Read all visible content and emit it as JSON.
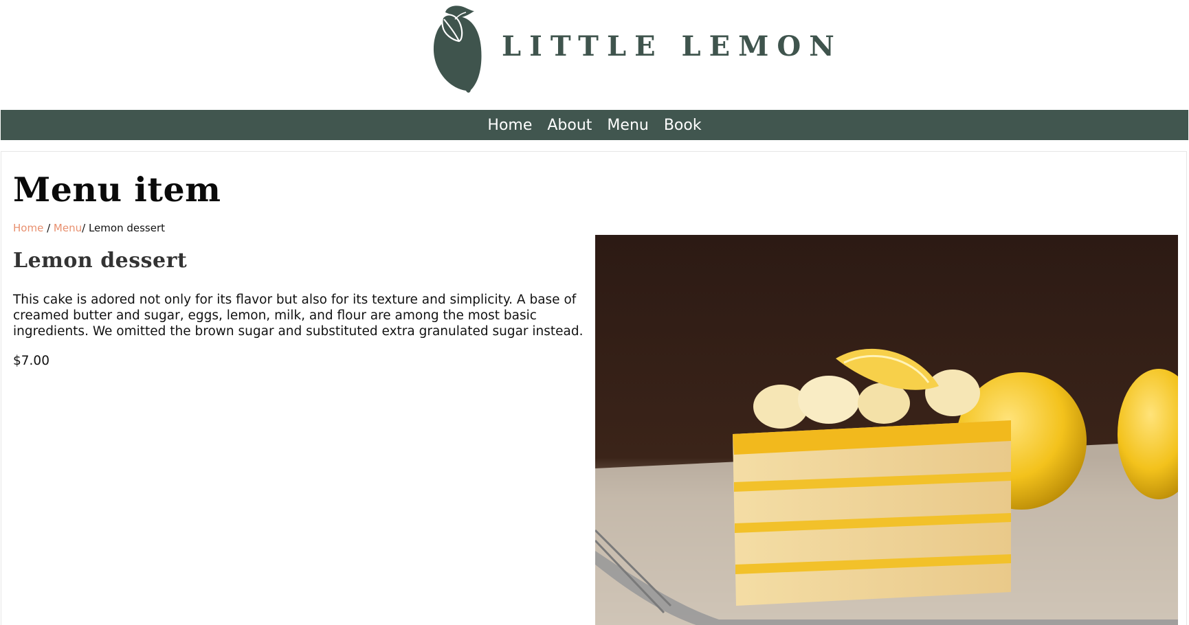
{
  "brand": {
    "name": "LITTLE LEMON",
    "color": "#3f544d"
  },
  "nav": {
    "items": [
      {
        "label": "Home"
      },
      {
        "label": "About"
      },
      {
        "label": "Menu"
      },
      {
        "label": "Book"
      }
    ],
    "background": "#41564f"
  },
  "page": {
    "title": "Menu item"
  },
  "breadcrumb": {
    "items": [
      {
        "label": "Home"
      },
      {
        "label": "Menu"
      }
    ],
    "separator": "/",
    "current": "Lemon dessert",
    "link_color": "#e8906f"
  },
  "item": {
    "name": "Lemon dessert",
    "description": "This cake is adored not only for its flavor but also for its texture and simplicity. A base of creamed butter and sugar, eggs, lemon, milk, and flour are among the most basic ingredients. We omitted the brown sugar and substituted extra granulated sugar instead.",
    "price": "$7.00"
  }
}
